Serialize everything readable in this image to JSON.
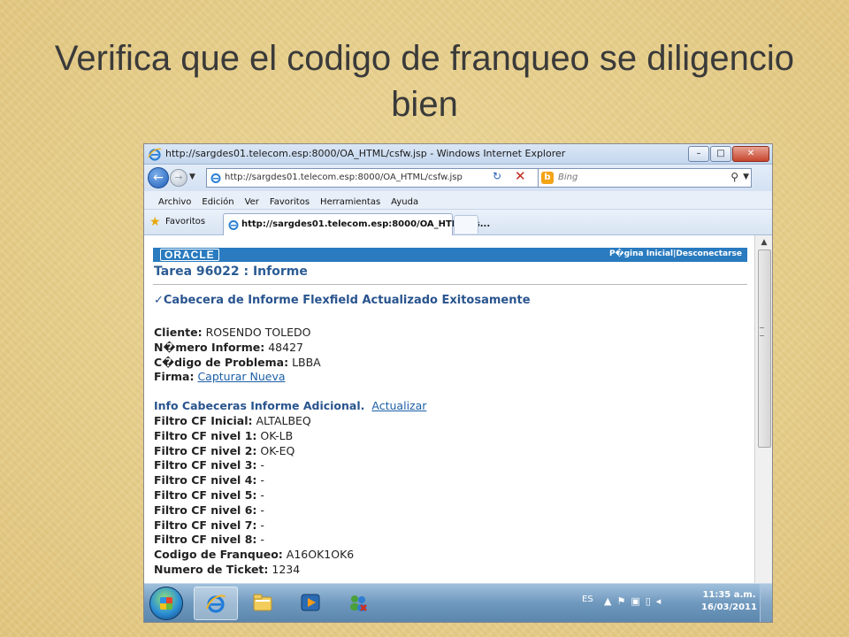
{
  "slide": {
    "title": "Verifica que el codigo de franqueo se diligencio bien"
  },
  "browser": {
    "window_title": "http://sargdes01.telecom.esp:8000/OA_HTML/csfw.jsp - Windows Internet Explorer",
    "window_buttons": {
      "minimize": "–",
      "maximize": "□",
      "close": "✕"
    },
    "address": "http://sargdes01.telecom.esp:8000/OA_HTML/csfw.jsp",
    "search_placeholder": "Bing",
    "search_engine_icon": "b",
    "menu": [
      "Archivo",
      "Edición",
      "Ver",
      "Favoritos",
      "Herramientas",
      "Ayuda"
    ],
    "favorites_label": "Favoritos",
    "tab_title": "http://sargdes01.telecom.esp:8000/OA_HTML/cs..."
  },
  "page": {
    "oracle_logo": "ORACLE",
    "header_links": "P�gina Inicial|Desconectarse",
    "heading": "Tarea 96022 : Informe",
    "success_message": "✓Cabecera de Informe Flexfield Actualizado Exitosamente",
    "fields": [
      {
        "label": "Cliente:",
        "value": "ROSENDO TOLEDO"
      },
      {
        "label": "N�mero Informe:",
        "value": "48427"
      },
      {
        "label": "C�digo de Problema:",
        "value": "LBBA"
      }
    ],
    "firma": {
      "label": "Firma:",
      "link": "Capturar Nueva"
    },
    "info_section": {
      "title": "Info Cabeceras Informe Adicional.",
      "link": "Actualizar"
    },
    "filters": [
      {
        "label": "Filtro CF Inicial:",
        "value": "ALTALBEQ"
      },
      {
        "label": "Filtro CF nivel 1:",
        "value": "OK-LB"
      },
      {
        "label": "Filtro CF nivel 2:",
        "value": "OK-EQ"
      },
      {
        "label": "Filtro CF nivel 3:",
        "value": "-"
      },
      {
        "label": "Filtro CF nivel 4:",
        "value": "-"
      },
      {
        "label": "Filtro CF nivel 5:",
        "value": "-"
      },
      {
        "label": "Filtro CF nivel 6:",
        "value": "-"
      },
      {
        "label": "Filtro CF nivel 7:",
        "value": "-"
      },
      {
        "label": "Filtro CF nivel 8:",
        "value": "-"
      },
      {
        "label": "Codigo de Franqueo:",
        "value": "A16OK1OK6"
      },
      {
        "label": "Numero de Ticket:",
        "value": "1234"
      }
    ]
  },
  "taskbar": {
    "language": "ES",
    "time": "11:35 a.m.",
    "date": "16/03/2011",
    "tray_icons": [
      "up-arrow-icon",
      "flag-icon",
      "network-icon",
      "battery-icon",
      "volume-icon"
    ],
    "tray_glyphs": "▲⚑▣▯◂"
  }
}
